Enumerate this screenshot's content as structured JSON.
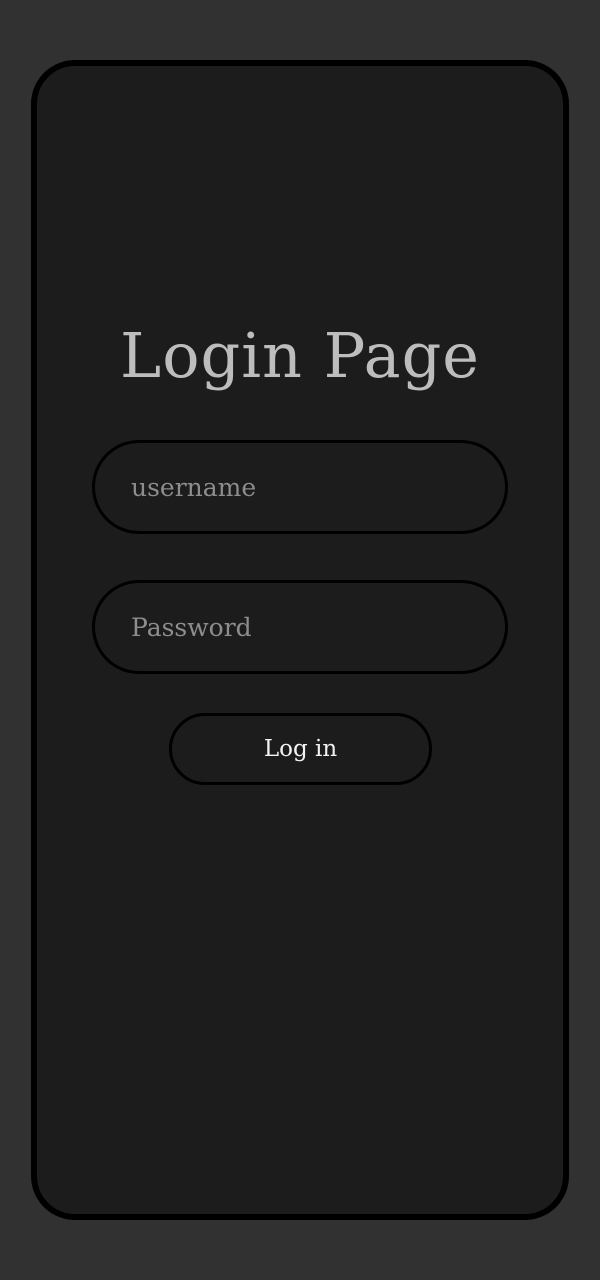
{
  "login": {
    "title": "Login Page",
    "username_placeholder": "username",
    "password_placeholder": "Password",
    "login_button_label": "Log in"
  },
  "colors": {
    "page_background": "#313131",
    "card_background": "#1c1c1c",
    "card_border": "#000000",
    "title_text": "#bdbdbd",
    "placeholder_text": "#8d8d8d",
    "button_text": "#f2f2f2"
  }
}
